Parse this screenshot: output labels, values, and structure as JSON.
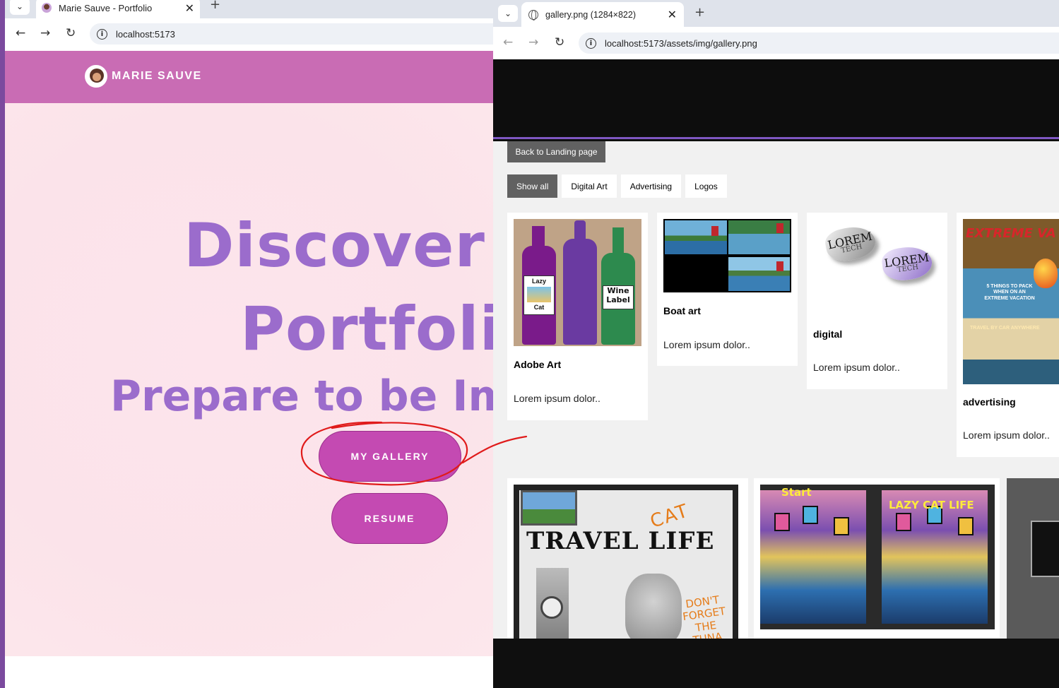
{
  "left_window": {
    "tab_title": "Marie Sauve - Portfolio",
    "url": "localhost:5173",
    "brand_name": "MARIE SAUVE",
    "hero_line1": "Discover",
    "hero_line2": "Portfoli",
    "hero_line3": "Prepare to be Imp",
    "gallery_button": "MY GALLERY",
    "resume_button": "RESUME"
  },
  "right_window": {
    "tab_title": "gallery.png (1284×822)",
    "url": "localhost:5173/assets/img/gallery.png",
    "back_button": "Back to Landing page",
    "filters": [
      {
        "label": "Show all",
        "active": true
      },
      {
        "label": "Digital Art",
        "active": false
      },
      {
        "label": "Advertising",
        "active": false
      },
      {
        "label": "Logos",
        "active": false
      }
    ],
    "cards": [
      {
        "title": "Adobe Art",
        "desc": "Lorem ipsum dolor.."
      },
      {
        "title": "Boat art",
        "desc": "Lorem ipsum dolor.."
      },
      {
        "title": "digital",
        "desc": "Lorem ipsum dolor.."
      },
      {
        "title": "advertising",
        "desc": "Lorem ipsum dolor.."
      }
    ],
    "thumb_text": {
      "wine_label_1_line1": "Lazy",
      "wine_label_1_line2": "Cat",
      "wine_label_3": "Wine Label",
      "logo_word": "LOREM",
      "logo_sub": "TECH",
      "adv_title": "EXTREME VA",
      "adv_text": "5 THINGS TO PACK WHEN ON AN EXTREME VACATION",
      "adv_text2": "TRAVEL BY CAR ANYWHERE",
      "travel_title": "TRAVEL LIFE",
      "travel_cat": "CAT",
      "travel_tuna": "DON'T FORGET THE TUNA",
      "lazycat_start": "Start",
      "lazycat_title": "LAZY CAT LIFE"
    }
  },
  "colors": {
    "header_pink": "#c96cb4",
    "hero_text_purple": "#9b6ccc",
    "button_magenta": "#c44ab2",
    "annotation_red": "#e01b1b",
    "accent_purple": "#7e57c2"
  }
}
